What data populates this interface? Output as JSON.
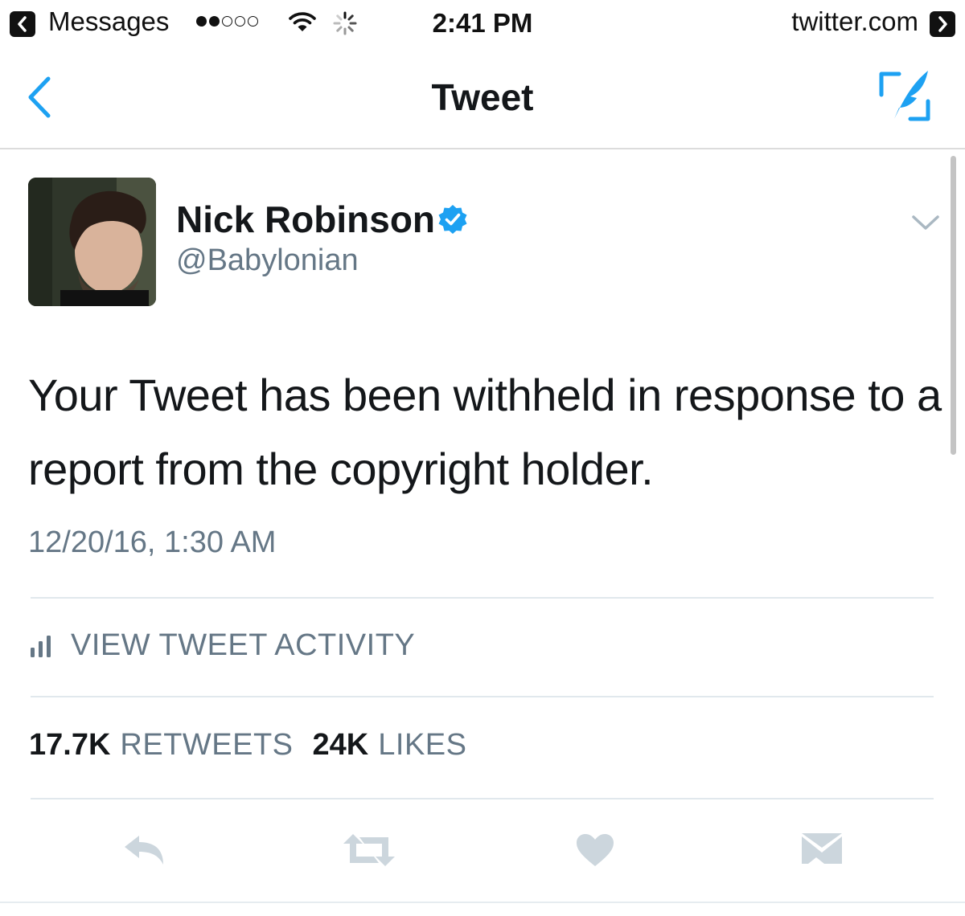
{
  "status_bar": {
    "back_app": "Messages",
    "time": "2:41 PM",
    "site": "twitter.com"
  },
  "nav": {
    "title": "Tweet"
  },
  "tweet": {
    "author_name": "Nick Robinson",
    "author_handle": "@Babylonian",
    "text": "Your Tweet has been withheld in response to a report from the copyright holder.",
    "timestamp": "12/20/16, 1:30 AM",
    "activity_label": "VIEW TWEET ACTIVITY",
    "retweets_count": "17.7K",
    "retweets_label": "RETWEETS",
    "likes_count": "24K",
    "likes_label": "LIKES"
  },
  "icons": {
    "back": "chevron-left-icon",
    "compose": "compose-tweet-icon",
    "verified": "verified-badge-icon",
    "caret": "chevron-down-icon",
    "activity": "bar-chart-icon",
    "reply": "reply-icon",
    "retweet": "retweet-icon",
    "like": "heart-icon",
    "dm": "envelope-icon"
  },
  "colors": {
    "accent": "#1da1f2",
    "secondary_text": "#657786",
    "action_icon": "#ccd6dd"
  }
}
